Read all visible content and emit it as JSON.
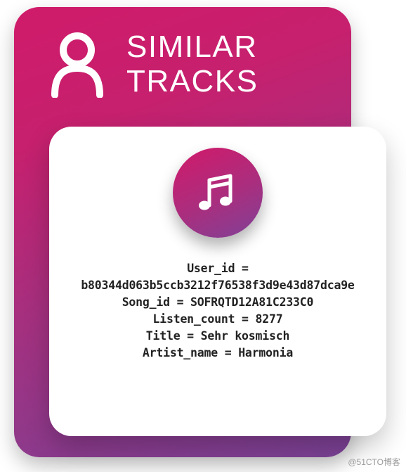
{
  "header": {
    "title_line1": "SIMILAR",
    "title_line2": "TRACKS"
  },
  "track": {
    "user_id_label": "User_id",
    "user_id_value": "b80344d063b5ccb3212f76538f3d9e43d87dca9e",
    "song_id_label": "Song_id",
    "song_id_value": "SOFRQTD12A81C233C0",
    "listen_count_label": "Listen_count",
    "listen_count_value": "8277",
    "title_label": "Title",
    "title_value": "Sehr kosmisch",
    "artist_label": "Artist_name",
    "artist_value": "Harmonia"
  },
  "watermark": "@51CTO博客"
}
